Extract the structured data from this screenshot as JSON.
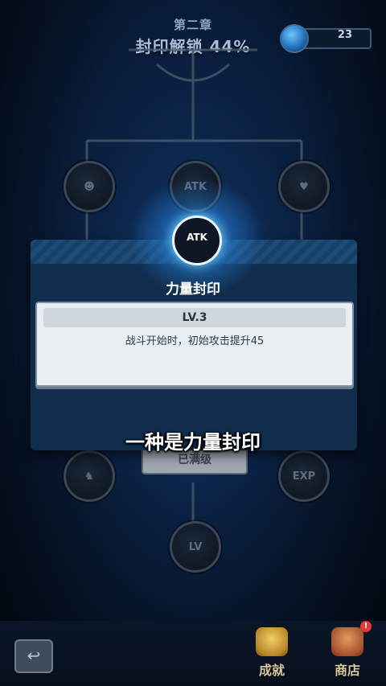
{
  "header": {
    "chapter": "第二章",
    "progress_label": "封印解锁 44%",
    "currency_value": "23"
  },
  "tree": {
    "nodes": [
      {
        "name": "demon-node",
        "icon": "demon-icon"
      },
      {
        "name": "atk-node",
        "icon": "sword-icon",
        "text": "ATK"
      },
      {
        "name": "heal-node",
        "icon": "heart-plus-icon"
      },
      {
        "name": "viking-node",
        "icon": "viking-helmet-icon"
      },
      {
        "name": "exp-node",
        "icon": "exp-icon",
        "text": "EXP"
      },
      {
        "name": "lv-node",
        "icon": "level-up-icon",
        "text": "LV"
      }
    ]
  },
  "modal": {
    "icon_text": "ATK",
    "title": "力量封印",
    "level": "LV.3",
    "description": "战斗开始时，初始攻击提升45"
  },
  "behind_button": "已满级",
  "subtitle": "一种是力量封印",
  "bottom_nav": {
    "back_icon": "back-arrow-icon",
    "items": [
      {
        "label": "成就",
        "icon": "trophy-icon"
      },
      {
        "label": "商店",
        "icon": "shop-icon",
        "badge": "!"
      }
    ]
  },
  "colors": {
    "accent_glow": "#50c8ff",
    "modal_bg": "#102d4c",
    "card_bg": "#e9eef3"
  }
}
